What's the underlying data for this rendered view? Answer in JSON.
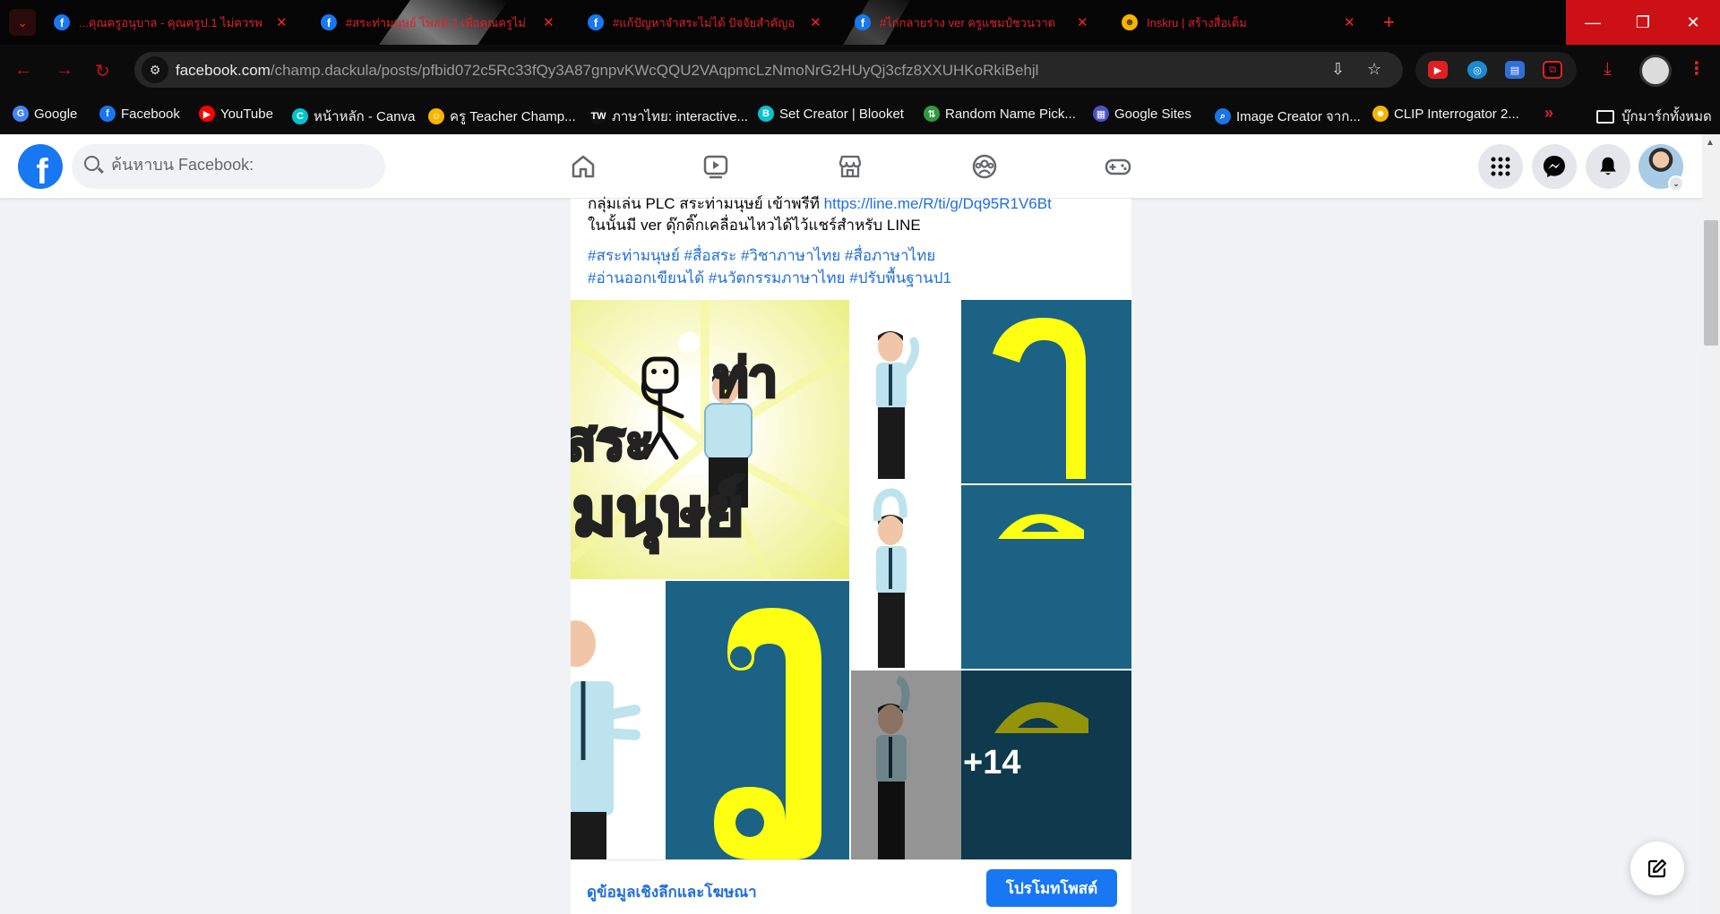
{
  "browser": {
    "tabs": [
      {
        "title": "...คุณครูอนุบาล - คุณครูป.1 ไม่ควรพ"
      },
      {
        "title": "#สระท่ามนุษย์ โพสต์ 2 เพื่อคุณครูไม่"
      },
      {
        "title": "#แก้ปัญหาจำสระไม่ได้ ปัจจัยสำคัญอ"
      },
      {
        "title": "#ไก่กลายร่าง ver ครูแชมป์ชวนวาด"
      },
      {
        "title": "Inskru | สร้างสื่อเต็ม"
      }
    ],
    "url_host": "facebook.com",
    "url_path": "/champ.dackula/posts/pfbid072c5Rc33fQy3A87gnpvKWcQQU2VAqpmcLzNmoNrG2HUyQj3cfz8XXUHKoRkiBehjl",
    "bookmarks": [
      {
        "label": "Google",
        "color": "#4285f4",
        "glyph": "G"
      },
      {
        "label": "Facebook",
        "color": "#1877f2",
        "glyph": "f"
      },
      {
        "label": "YouTube",
        "color": "#ff0000",
        "glyph": "▶"
      },
      {
        "label": "หน้าหลัก - Canva",
        "color": "#00c4cc",
        "glyph": "C"
      },
      {
        "label": "ครู Teacher Champ...",
        "color": "#f5b400",
        "glyph": "☺"
      },
      {
        "label": "ภาษาไทย: interactive...",
        "color": "#111111",
        "glyph": "TW"
      },
      {
        "label": "Set Creator | Blooket",
        "color": "#0bc2cf",
        "glyph": "B"
      },
      {
        "label": "Random Name Pick...",
        "color": "#2e9b3e",
        "glyph": "⇅"
      },
      {
        "label": "Google Sites",
        "color": "#4b53c3",
        "glyph": "▦"
      },
      {
        "label": "Image Creator จาก...",
        "color": "#1a73e8",
        "glyph": "⌕"
      },
      {
        "label": "CLIP Interrogator 2...",
        "color": "#f5b400",
        "glyph": "☻"
      }
    ],
    "bookmarks_all": "บุ๊กมาร์กทั้งหมด"
  },
  "facebook": {
    "search_placeholder": "ค้นหาบน Facebook:"
  },
  "post": {
    "line1_text": "กลุ่มเล่น PLC สระท่ามนุษย์ เข้าพรีที  ",
    "line1_link": "https://line.me/R/ti/g/Dq95R1V6Bt",
    "line2_text": "ในนั้นมี ver ดุ๊กดิ๊กเคลื่อนไหวได้ไว้แชร์สำหรับ LINE",
    "hashtags_line1": "#สระท่ามนุษย์ #สื่อสระ #วิชาภาษาไทย #สื่อภาษาไทย",
    "hashtags_line2": "#อ่านออกเขียนได้ #นวัตกรรมภาษาไทย #ปรับพื้นฐานป1",
    "gallery": {
      "main_image_text_1": "สระ",
      "main_image_text_2": "ท่า",
      "main_image_text_3": "มนุษย์",
      "more_count": "+14"
    },
    "insights_link": "ดูข้อมูลเชิงลึกและโฆษณา",
    "promote_button": "โปรโมทโพสต์"
  }
}
